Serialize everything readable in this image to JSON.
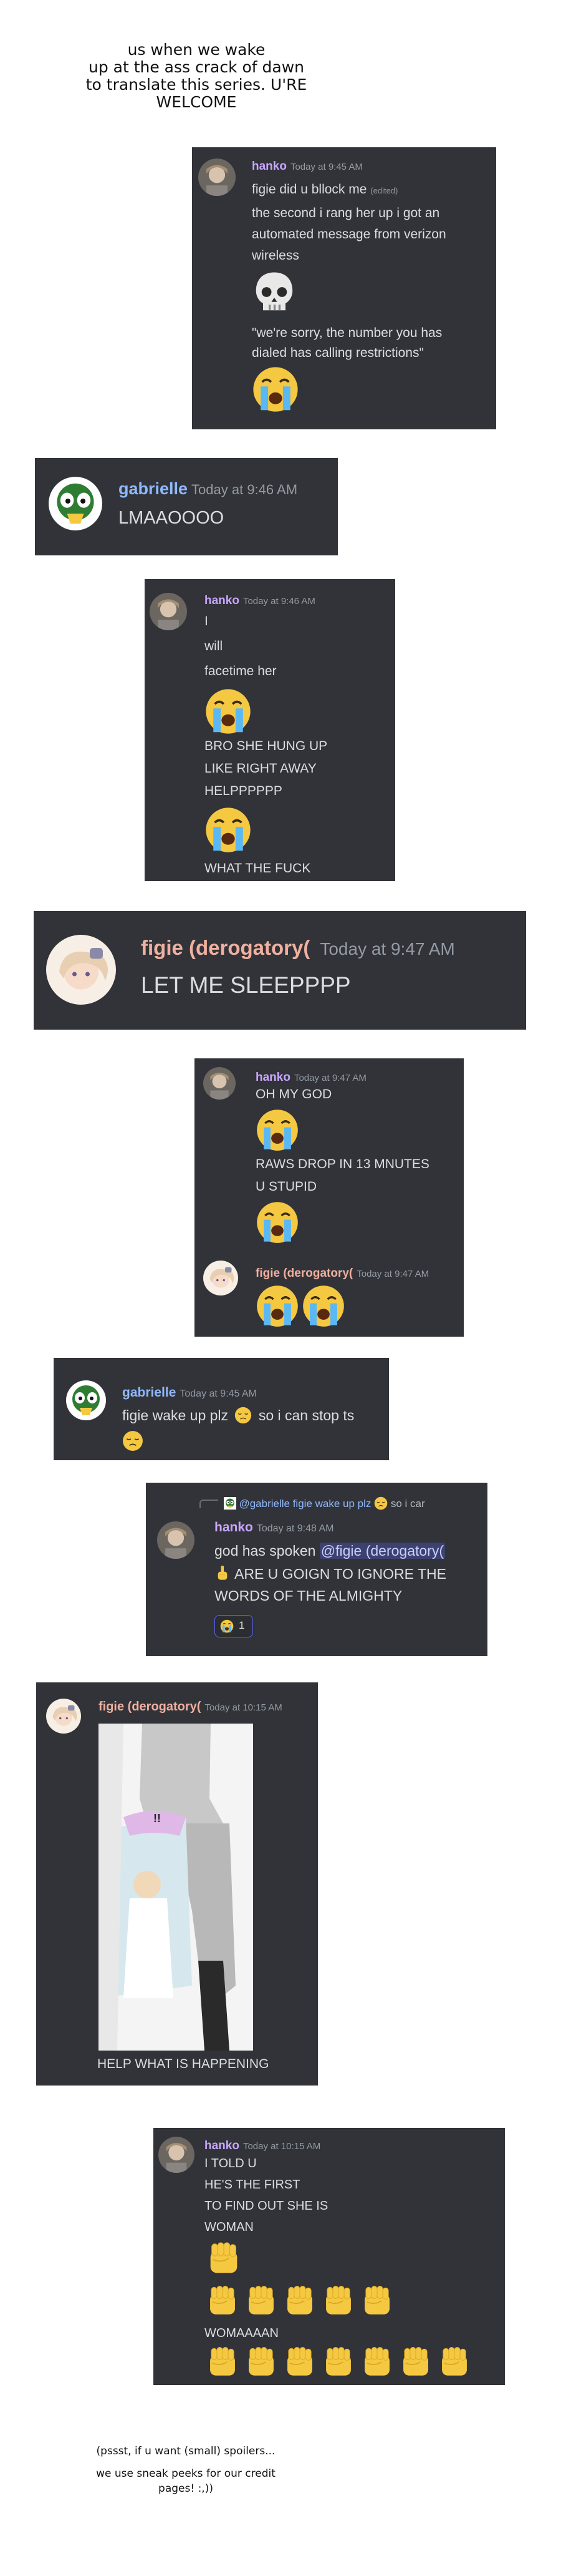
{
  "top_note": [
    "us when we wake",
    "up at the ass crack of dawn",
    "to translate this series. U'RE",
    "WELCOME"
  ],
  "panel1": {
    "user": "hanko",
    "time": "Today at 9:45 AM",
    "line1": "figie did u bllock me",
    "edited": "(edited)",
    "lines": [
      "the second i rang her up i got an",
      "automated message from verizon",
      "wireless"
    ],
    "quote": [
      "\"we're sorry, the number you has",
      "dialed has calling restrictions\""
    ]
  },
  "panel2": {
    "user": "gabrielle",
    "time": "Today at 9:46 AM",
    "text": "LMAAOOOO"
  },
  "panel3": {
    "user": "hanko",
    "time": "Today at 9:46 AM",
    "lines_a": [
      "I",
      "will",
      "facetime her"
    ],
    "lines_b": [
      "BRO SHE HUNG UP",
      "LIKE RIGHT AWAY",
      "HELPPPPPP"
    ],
    "last": "WHAT THE FUCK"
  },
  "panel4": {
    "user": "figie (derogatory(",
    "time": "Today at 9:47 AM",
    "text": "LET ME SLEEPPPP"
  },
  "panel5": {
    "user": "hanko",
    "time": "Today at 9:47 AM",
    "line1": "OH MY GOD",
    "line2": "RAWS DROP IN 13 MNUTES",
    "line3": "U STUPID",
    "user2": "figie (derogatory(",
    "time2": "Today at 9:47 AM"
  },
  "panel6": {
    "user": "gabrielle",
    "time": "Today at 9:45 AM",
    "text1": "figie wake up plz",
    "text2": "so i can stop ts"
  },
  "panel7": {
    "reply": "@gabrielle figie wake up plz",
    "reply_tail": "so i car",
    "user": "hanko",
    "time": "Today at 9:48 AM",
    "line1": "god has spoken",
    "mention": "@figie (derogatory(",
    "line2": "ARE U GOIGN TO IGNORE THE",
    "line3": "WORDS OF THE ALMIGHTY",
    "reaction_count": "1"
  },
  "panel8": {
    "user": "figie (derogatory(",
    "time": "Today at 10:15 AM",
    "manga_text": "!!",
    "caption": "HELP WHAT IS HAPPENING"
  },
  "panel9": {
    "user": "hanko",
    "time": "Today at 10:15 AM",
    "lines": [
      "I TOLD U",
      "HE'S THE FIRST",
      "TO FIND OUT SHE IS",
      "WOMAN"
    ],
    "last": "WOMAAAAN"
  },
  "bottom_note": [
    "(pssst, if u want (small) spoilers...",
    "we use sneak peeks for our credit",
    "pages! :,))"
  ],
  "colors": {
    "panel_bg": "#313338",
    "hanko": "#c9a6ff",
    "gabrielle": "#8fb9ff",
    "figie": "#f0b0a0",
    "emoji": "#f5c842"
  }
}
